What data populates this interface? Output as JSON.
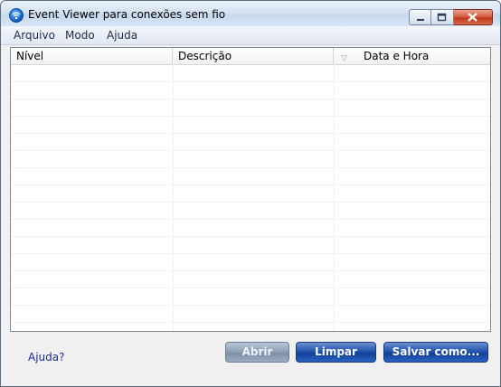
{
  "window": {
    "title": "Event Viewer para conexões sem fio"
  },
  "menubar": {
    "items": [
      "Arquivo",
      "Modo",
      "Ajuda"
    ]
  },
  "list": {
    "columns": [
      "Nível",
      "Descrição",
      "Data e Hora"
    ],
    "sort_column": "Data e Hora",
    "rows": []
  },
  "footer": {
    "help_link": "Ajuda?",
    "open_label": "Abrir",
    "clear_label": "Limpar",
    "save_as_label": "Salvar como..."
  },
  "colors": {
    "button_primary": "#1d4ea8",
    "button_disabled": "#8e9db3",
    "link": "#1a2c8a"
  }
}
